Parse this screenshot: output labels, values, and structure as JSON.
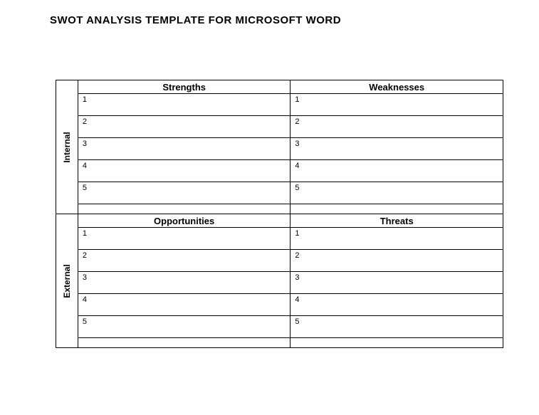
{
  "title": "SWOT ANALYSIS TEMPLATE FOR MICROSOFT WORD",
  "sections": {
    "internal": {
      "label": "Internal",
      "left": {
        "header": "Strengths",
        "rows": [
          "1",
          "2",
          "3",
          "4",
          "5"
        ]
      },
      "right": {
        "header": "Weaknesses",
        "rows": [
          "1",
          "2",
          "3",
          "4",
          "5"
        ]
      }
    },
    "external": {
      "label": "External",
      "left": {
        "header": "Opportunities",
        "rows": [
          "1",
          "2",
          "3",
          "4",
          "5"
        ]
      },
      "right": {
        "header": "Threats",
        "rows": [
          "1",
          "2",
          "3",
          "4",
          "5"
        ]
      }
    }
  }
}
